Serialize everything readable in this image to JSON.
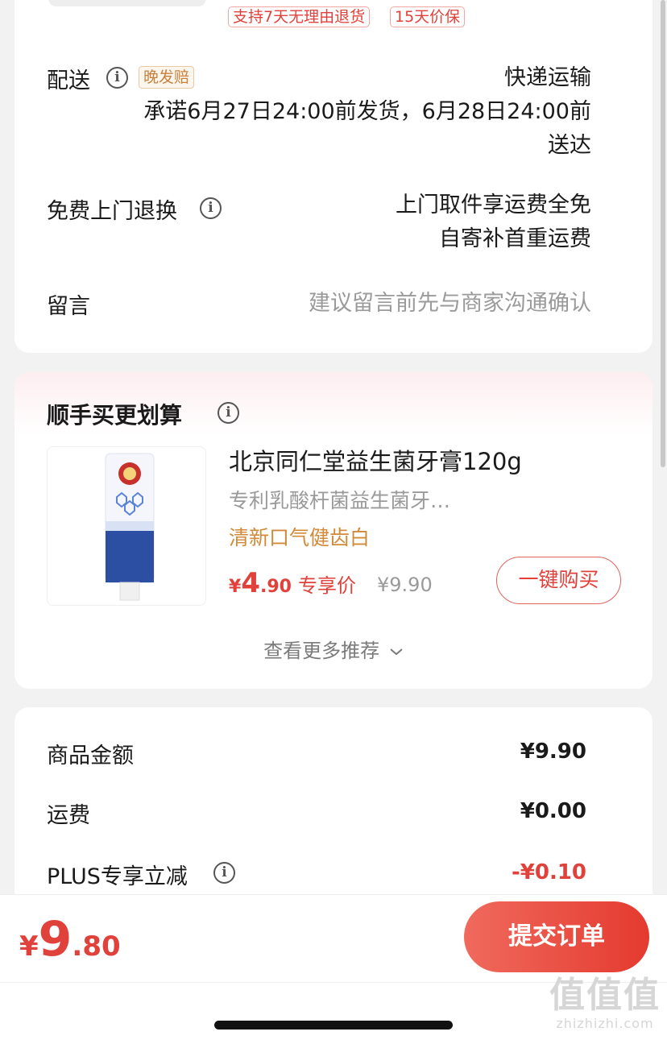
{
  "service_tags": [
    "支持7天无理由退货",
    "15天价保"
  ],
  "delivery": {
    "label": "配送",
    "late_tag": "晚发赔",
    "method": "快递运输",
    "promise_line1": "承诺6月27日24:00前发货，6月28日24:00前",
    "promise_line2": "送达"
  },
  "return_service": {
    "label": "免费上门退换",
    "line1": "上门取件享运费全免",
    "line2": "自寄补首重运费"
  },
  "message": {
    "label": "留言",
    "placeholder": "建议留言前先与商家沟通确认"
  },
  "recommend": {
    "title": "顺手买更划算",
    "product": {
      "name": "北京同仁堂益生菌牙膏120g",
      "desc": "专利乳酸杆菌益生菌牙…",
      "slogan": "清新口气健齿白",
      "price_symbol": "¥",
      "price_int": "4",
      "price_dec": ".90",
      "price_tag": "专享价",
      "original_price": "¥9.90",
      "buy_label": "一键购买"
    },
    "more_label": "查看更多推荐"
  },
  "summary": {
    "rows": [
      {
        "label": "商品金额",
        "value": "¥9.90"
      },
      {
        "label": "运费",
        "value": "¥0.00"
      },
      {
        "label": "PLUS专享立减",
        "value": "-¥0.10"
      }
    ]
  },
  "footer": {
    "total_symbol": "¥",
    "total_int": "9",
    "total_dec": ".80",
    "submit_label": "提交订单"
  },
  "watermark": {
    "big": "值值值",
    "small": "zhizhizhi.com"
  },
  "colors": {
    "accent_red": "#e0413a",
    "slogan_orange": "#d08a38",
    "late_tag_text": "#c9803a"
  },
  "icons": [
    "info-icon",
    "chevron-down-icon"
  ]
}
